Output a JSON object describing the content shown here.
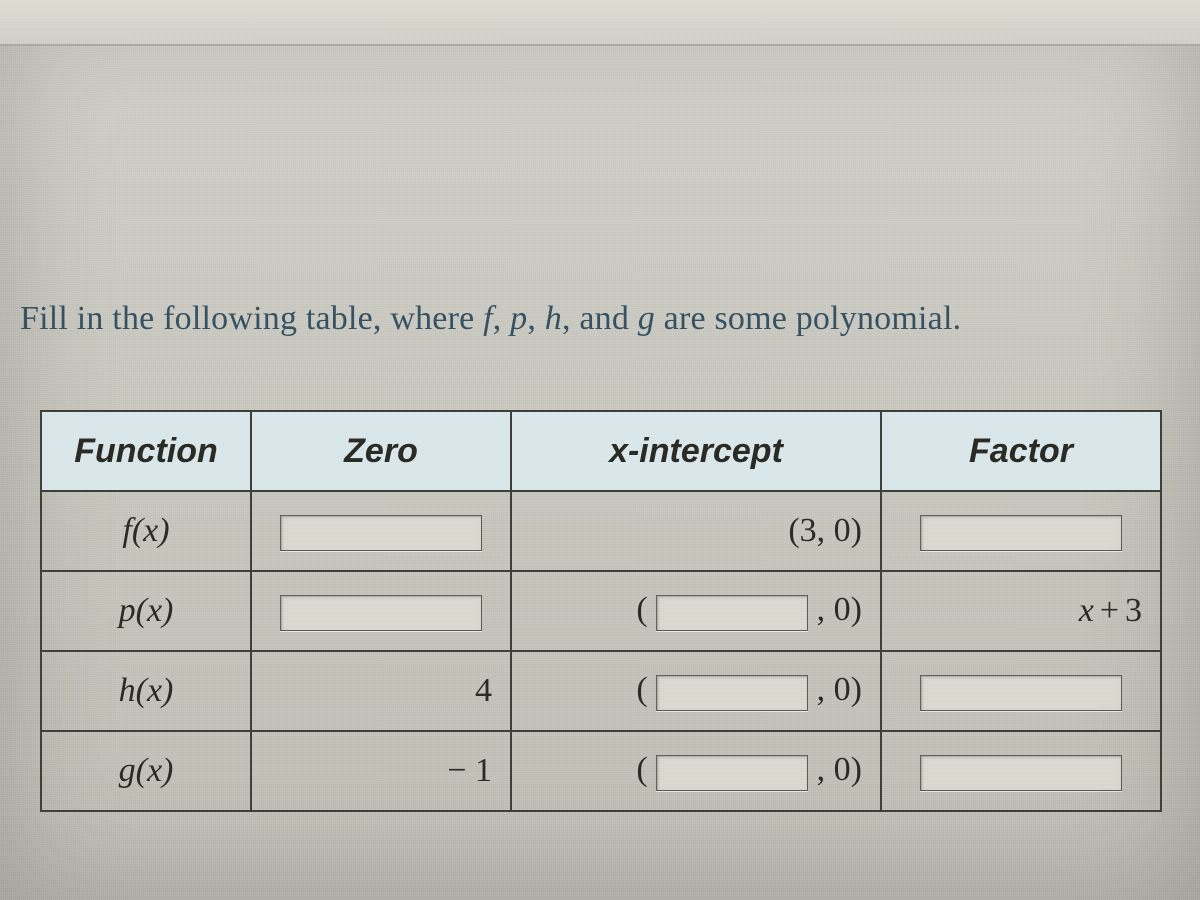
{
  "prompt": {
    "pre": "Fill in the following table, where ",
    "f": "f",
    "sep1": ", ",
    "p": "p",
    "sep2": ", ",
    "h": "h",
    "sep3": ", and ",
    "g": "g",
    "post": " are some polynomial."
  },
  "headers": {
    "function": "Function",
    "zero": "Zero",
    "xintercept": "x-intercept",
    "factor": "Factor"
  },
  "rows": {
    "f": {
      "fn_name": "f",
      "fn_arg": "x",
      "xint_text": "(3, 0)"
    },
    "p": {
      "fn_name": "p",
      "fn_arg": "x",
      "xint_open": "(",
      "xint_close": ", 0)",
      "factor_x": "x",
      "factor_op": "+",
      "factor_n": "3"
    },
    "h": {
      "fn_name": "h",
      "fn_arg": "x",
      "zero": "4",
      "xint_open": "(",
      "xint_close": ", 0)"
    },
    "g": {
      "fn_name": "g",
      "fn_arg": "x",
      "zero": "− 1",
      "xint_open": "(",
      "xint_close": ", 0)"
    }
  }
}
